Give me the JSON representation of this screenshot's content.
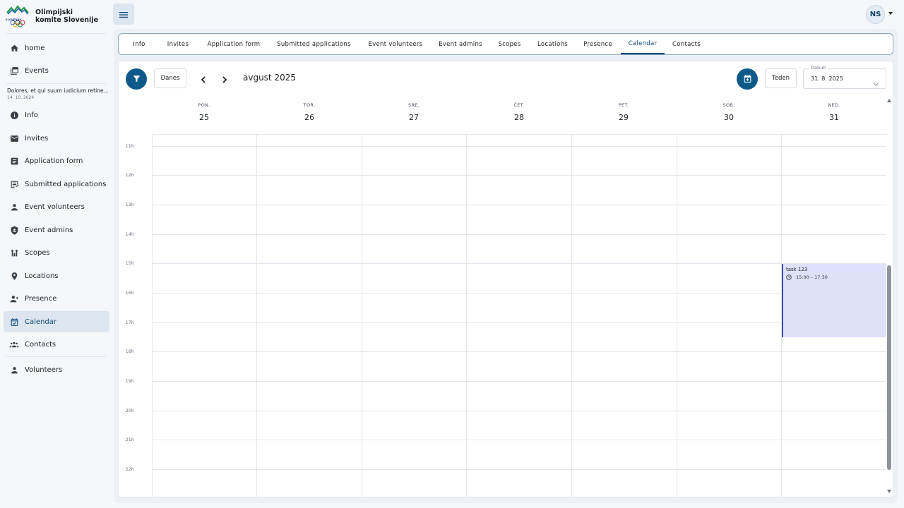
{
  "brand": {
    "name": "Olimpijski komite Slovenije",
    "logo_text": "SLOVENIJA"
  },
  "colors": {
    "accent": "#0d5a8a",
    "active_nav_bg": "#dde6f0",
    "event_bg": "#dfe1fb",
    "event_border": "#3c4fa8"
  },
  "sidebar": {
    "top_items": [
      {
        "label": "home",
        "icon": "home-icon"
      },
      {
        "label": "Events",
        "icon": "events-icon"
      }
    ],
    "event": {
      "title": "Dolores, et qui suum iudicium retine...",
      "date": "14. 10. 2024"
    },
    "event_items": [
      {
        "label": "Info",
        "icon": "info-icon"
      },
      {
        "label": "Invites",
        "icon": "mail-icon"
      },
      {
        "label": "Application form",
        "icon": "form-icon"
      },
      {
        "label": "Submitted applications",
        "icon": "submitted-icon"
      },
      {
        "label": "Event volunteers",
        "icon": "person-icon"
      },
      {
        "label": "Event admins",
        "icon": "shield-icon"
      },
      {
        "label": "Scopes",
        "icon": "scopes-icon"
      },
      {
        "label": "Locations",
        "icon": "location-icon"
      },
      {
        "label": "Presence",
        "icon": "presence-icon"
      },
      {
        "label": "Calendar",
        "icon": "calendar-check-icon",
        "active": true
      },
      {
        "label": "Contacts",
        "icon": "contacts-icon"
      }
    ],
    "bottom_items": [
      {
        "label": "Volunteers",
        "icon": "person-icon"
      }
    ]
  },
  "user": {
    "initials": "NS"
  },
  "tabs": [
    "Info",
    "Invites",
    "Application form",
    "Submitted applications",
    "Event volunteers",
    "Event admins",
    "Scopes",
    "Locations",
    "Presence",
    "Calendar",
    "Contacts"
  ],
  "active_tab": "Calendar",
  "toolbar": {
    "today_label": "Danes",
    "month_title": "avgust 2025",
    "view_label": "Teden",
    "date_label": "Datum",
    "date_value": "31. 8. 2025"
  },
  "week": {
    "days": [
      {
        "name": "PON.",
        "num": "25"
      },
      {
        "name": "TOR.",
        "num": "26"
      },
      {
        "name": "SRE.",
        "num": "27"
      },
      {
        "name": "ČET.",
        "num": "28"
      },
      {
        "name": "PET.",
        "num": "29"
      },
      {
        "name": "SOB.",
        "num": "30"
      },
      {
        "name": "NED.",
        "num": "31"
      }
    ],
    "hours": [
      "11h",
      "12h",
      "13h",
      "14h",
      "15h",
      "16h",
      "17h",
      "18h",
      "19h",
      "20h",
      "21h",
      "22h"
    ]
  },
  "events": [
    {
      "title": "task 123",
      "time": "15:00 – 17:30",
      "day": "31"
    }
  ]
}
